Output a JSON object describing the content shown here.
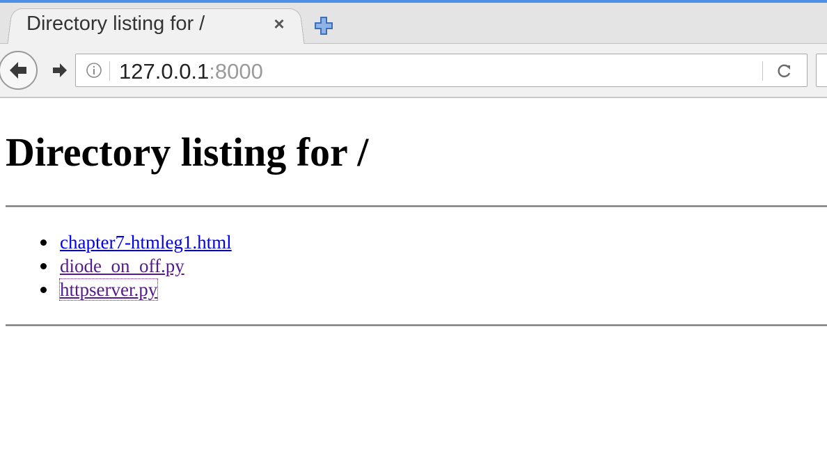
{
  "browser": {
    "tab_title": "Directory listing for /",
    "close_glyph": "×",
    "url_host": "127.0.0.1",
    "url_port": ":8000",
    "accent_color": "#4f8fe6",
    "icons": {
      "new_tab": "plus-icon",
      "back": "arrow-left-icon",
      "forward": "arrow-right-icon",
      "info": "info-icon",
      "reload": "reload-icon"
    }
  },
  "page": {
    "title": "Directory listing for /",
    "files": [
      {
        "name": "chapter7-htmleg1.html",
        "state": "unvisited"
      },
      {
        "name": "diode_on_off.py",
        "state": "visited"
      },
      {
        "name": "httpserver.py",
        "state": "visited-focused"
      }
    ],
    "link_colors": {
      "unvisited": "#0000ee",
      "visited": "#551a8b"
    }
  }
}
